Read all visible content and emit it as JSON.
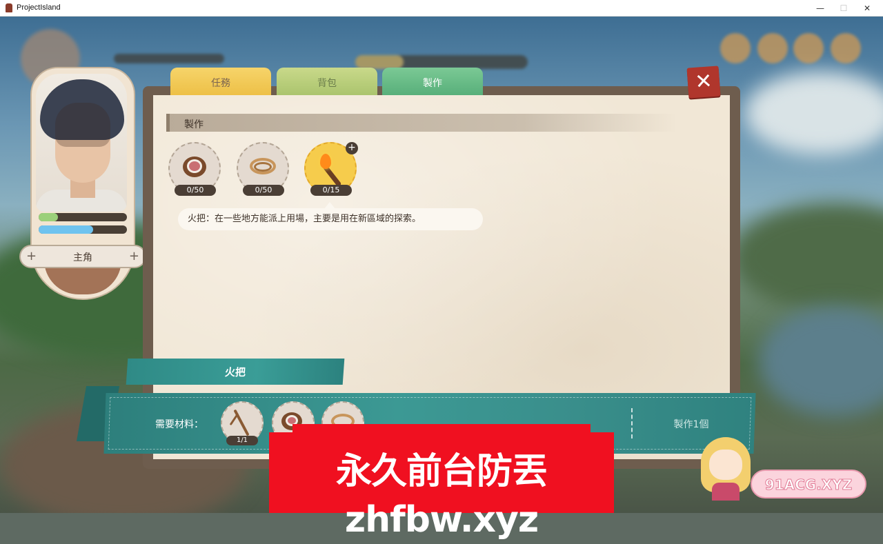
{
  "window": {
    "title": "ProjectIsland",
    "minimize": "—",
    "maximize": "☐",
    "close": "✕"
  },
  "character": {
    "name": "主角",
    "hp_fraction": 0.22,
    "mp_fraction": 0.62,
    "left_control": "+",
    "right_control": "+"
  },
  "tabs": [
    {
      "label": "任務"
    },
    {
      "label": "背包"
    },
    {
      "label": "製作",
      "active": true
    }
  ],
  "close_label": "✕",
  "section": {
    "title": "製作"
  },
  "items": [
    {
      "icon": "coconut-icon",
      "count": "0/50"
    },
    {
      "icon": "rope-icon",
      "count": "0/50"
    },
    {
      "icon": "torch-icon",
      "count": "0/15",
      "selected": true,
      "badge": "+"
    }
  ],
  "tooltip": {
    "text": "火把：在一些地方能派上用場，主要是用在新區域的探索。"
  },
  "recipe": {
    "name": "火把",
    "materials_label": "需要材料：",
    "materials": [
      {
        "icon": "twig-icon",
        "count": "1/1"
      },
      {
        "icon": "coconut-icon",
        "count": ""
      },
      {
        "icon": "rope-icon",
        "count": ""
      }
    ],
    "craft_button": "製作1個"
  },
  "overlay": {
    "banner_text": "永久前台防丟zhfbw.xyz",
    "watermark_text": "91ACG.XYZ"
  },
  "colors": {
    "craft_tab": "#56ae79",
    "quest_tab": "#edbf45",
    "bag_tab": "#a9c36c",
    "close_button": "#b0362c",
    "ribbon": "#3a9d97",
    "selected_item": "#f6cc4c"
  }
}
